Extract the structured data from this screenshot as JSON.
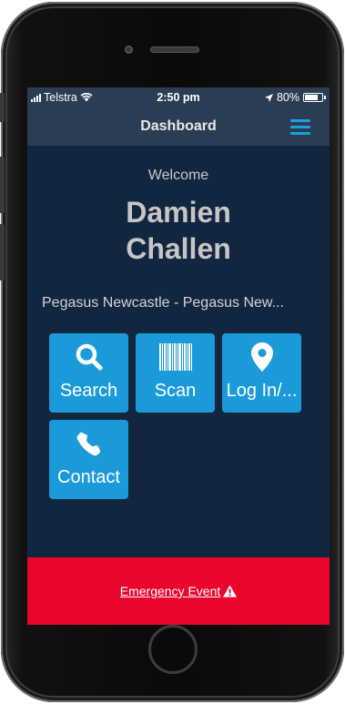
{
  "status_bar": {
    "carrier": "Telstra",
    "time": "2:50 pm",
    "battery_text": "80%",
    "battery_level": 0.8
  },
  "nav": {
    "title": "Dashboard"
  },
  "main": {
    "welcome": "Welcome",
    "name_line1": "Damien",
    "name_line2": "Challen",
    "location": "Pegasus Newcastle - Pegasus New..."
  },
  "tiles": [
    {
      "label": "Search",
      "icon": "search-icon"
    },
    {
      "label": "Scan",
      "icon": "barcode-icon"
    },
    {
      "label": "Log In/...",
      "icon": "map-pin-icon"
    },
    {
      "label": "Contact",
      "icon": "phone-icon"
    }
  ],
  "emergency": {
    "label": "Emergency Event",
    "icon": "warning-icon"
  },
  "colors": {
    "accent": "#1a9ad8",
    "background": "#12263f",
    "navbar": "#2b3d52",
    "emergency": "#e8062d"
  }
}
